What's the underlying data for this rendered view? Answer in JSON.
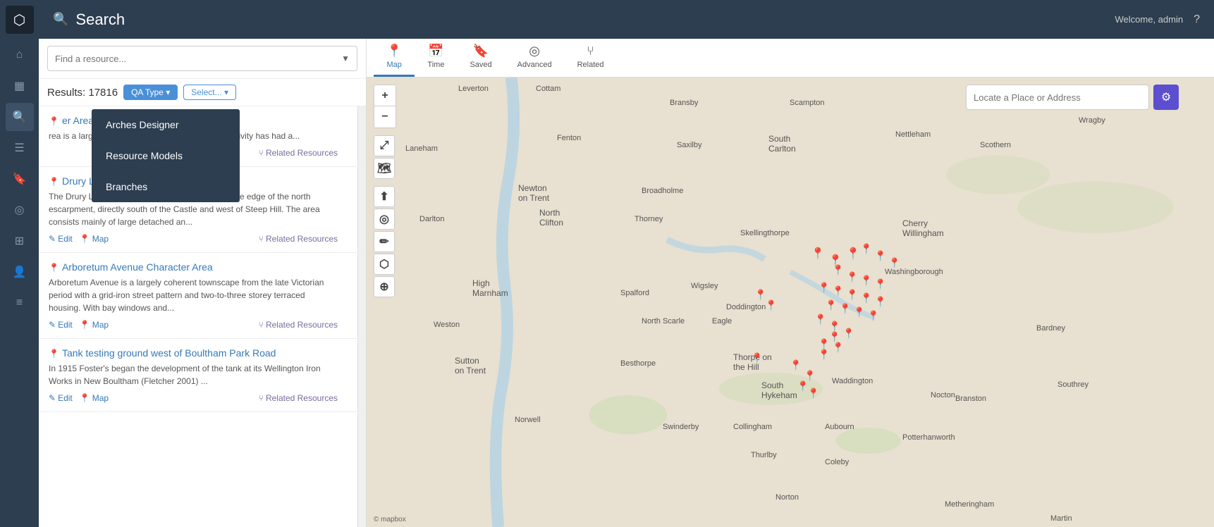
{
  "app": {
    "logo_icon": "⬡",
    "header_title": "Search",
    "welcome_text": "Welcome, admin",
    "question_icon": "?"
  },
  "sidebar": {
    "icons": [
      {
        "name": "home-icon",
        "glyph": "⌂",
        "active": false
      },
      {
        "name": "dashboard-icon",
        "glyph": "▦",
        "active": false
      },
      {
        "name": "search-icon",
        "glyph": "🔍",
        "active": true
      },
      {
        "name": "list-icon",
        "glyph": "☰",
        "active": false
      },
      {
        "name": "bookmark-icon",
        "glyph": "🔖",
        "active": false
      },
      {
        "name": "globe-icon",
        "glyph": "◎",
        "active": false
      },
      {
        "name": "grid-icon",
        "glyph": "⊞",
        "active": false
      },
      {
        "name": "user-icon",
        "glyph": "👤",
        "active": false
      },
      {
        "name": "lines-icon",
        "glyph": "≡",
        "active": false
      }
    ]
  },
  "search": {
    "placeholder": "Find a resource...",
    "results_label": "Results:",
    "results_count": "17816",
    "filter1_label": "QA Type ▾",
    "filter2_label": "Select... ▾"
  },
  "toolbar": {
    "tabs": [
      {
        "id": "map",
        "icon": "📍",
        "label": "Map",
        "active": true
      },
      {
        "id": "time",
        "icon": "📅",
        "label": "Time",
        "active": false
      },
      {
        "id": "saved",
        "icon": "🔖",
        "label": "Saved",
        "active": false
      },
      {
        "id": "advanced",
        "icon": "◎",
        "label": "Advanced",
        "active": false
      },
      {
        "id": "related",
        "icon": "⑂",
        "label": "Related",
        "active": false
      }
    ]
  },
  "resources": [
    {
      "id": 1,
      "has_pin": true,
      "title": "er Area",
      "description": "rea is a large area of land quarrying until as ale activity has had a...",
      "edit_label": "",
      "map_label": "",
      "related_label": "Related Resources"
    },
    {
      "id": 2,
      "has_pin": true,
      "title": "Drury Lane Character Area",
      "description": "The Drury Lane Character Area is situated along the edge of the north escarpment, directly south of the Castle and west of Steep Hill. The area consists mainly of large detached an...",
      "edit_label": "Edit",
      "map_label": "Map",
      "related_label": "Related Resources"
    },
    {
      "id": 3,
      "has_pin": true,
      "title": "Arboretum Avenue Character Area",
      "description": "Arboretum Avenue is a largely coherent townscape from the late Victorian period with a grid-iron street pattern and two-to-three storey terraced housing. With bay windows and...",
      "edit_label": "Edit",
      "map_label": "Map",
      "related_label": "Related Resources"
    },
    {
      "id": 4,
      "has_pin": true,
      "title": "Tank testing ground west of Boultham Park Road",
      "description": "In 1915 Foster's began the development of the tank at its Wellington Iron Works in New Boultham (Fletcher 2001) ...",
      "edit_label": "Edit",
      "map_label": "Map",
      "related_label": "Related Resources"
    }
  ],
  "dropdown_menu": {
    "items": [
      {
        "label": "Arches Designer"
      },
      {
        "label": "Resource Models"
      },
      {
        "label": "Branches"
      }
    ]
  },
  "locate": {
    "placeholder": "Locate a Place or Address",
    "settings_icon": "⚙"
  },
  "map": {
    "attribution": "© mapbox"
  },
  "map_places": [
    "Leverton",
    "Cottam",
    "Bransby",
    "Scampton",
    "Laneham",
    "Fenton",
    "Saxilby",
    "South Carlton",
    "Nettleham",
    "Newton on Trent",
    "Broadholme",
    "Darlton",
    "North Clifton",
    "Thorney",
    "Skellingthorpe",
    "Cherry Willingham",
    "High Marnham",
    "Spalford",
    "Wigsley",
    "Doddington",
    "Washingborough",
    "Weston",
    "North Scarle",
    "Eagle",
    "Sutton on Trent",
    "Besthorpe",
    "Thorpe on the Hill",
    "South Hykeham",
    "Waddington",
    "Nocton",
    "Norwell",
    "Swinderby",
    "Collingham",
    "Aubourn",
    "Thurlby",
    "Coleby",
    "Potterhanworth",
    "Branston",
    "Bardney",
    "Southrey",
    "Wragby",
    "Scothern",
    "Norton",
    "Metheringham",
    "Martin"
  ]
}
